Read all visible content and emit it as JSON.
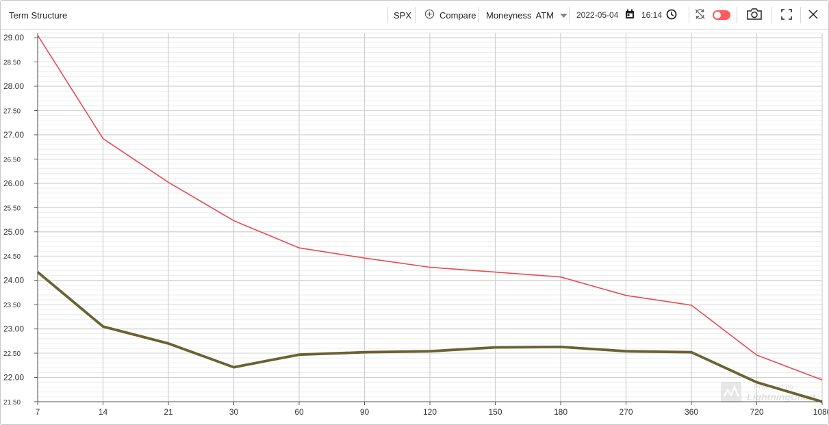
{
  "toolbar": {
    "title": "Term Structure",
    "symbol": "SPX",
    "compare_label": "Compare",
    "moneyness_label": "Moneyness",
    "moneyness_value": "ATM",
    "date": "2022-05-04",
    "time": "16:14"
  },
  "watermark": {
    "line1": "Powered by",
    "line2": "LightningChart"
  },
  "colors": {
    "series1": "#e84a4f",
    "series2": "#6b6232",
    "grid_major": "#cfcfcf",
    "grid_minor": "#e9e9e9",
    "toggle": "#ff5a5f"
  },
  "icons": [
    "plus-circle-icon",
    "chevron-down-icon",
    "calendar-icon",
    "clock-icon",
    "sync-icon",
    "toggle-icon",
    "camera-icon",
    "fullscreen-icon",
    "close-icon"
  ],
  "chart_data": {
    "type": "line",
    "categories": [
      "7",
      "14",
      "21",
      "30",
      "60",
      "90",
      "120",
      "150",
      "180",
      "270",
      "360",
      "720",
      "1080"
    ],
    "series": [
      {
        "values": [
          29.05,
          26.92,
          26.02,
          25.23,
          24.67,
          24.46,
          24.27,
          24.17,
          24.07,
          23.69,
          23.49,
          22.46,
          21.95
        ]
      },
      {
        "values": [
          24.17,
          23.05,
          22.7,
          22.21,
          22.47,
          22.52,
          22.54,
          22.62,
          22.63,
          22.54,
          22.52,
          21.9,
          21.5
        ]
      }
    ],
    "y_ticks": [
      "21.50",
      "22.00",
      "22.50",
      "23.00",
      "23.50",
      "24.00",
      "24.50",
      "25.00",
      "25.50",
      "26.00",
      "26.50",
      "27.00",
      "27.50",
      "28.00",
      "28.50",
      "29.00"
    ],
    "ylim": [
      21.5,
      29.1
    ],
    "grid": true
  }
}
